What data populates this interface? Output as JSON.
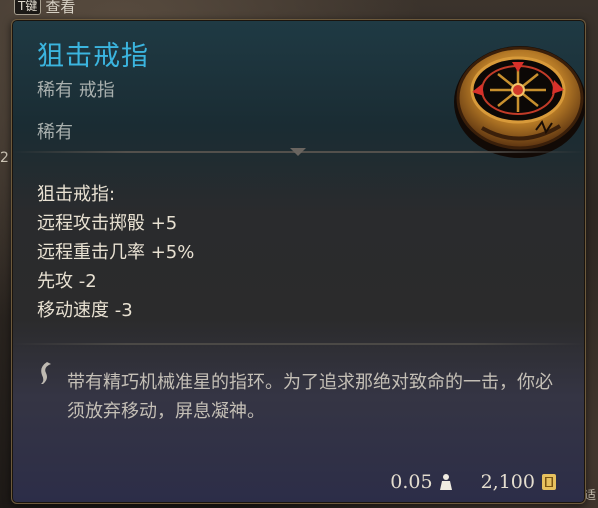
{
  "background": {
    "hint_key": "T键",
    "hint_text": "查看",
    "edge_left": "2",
    "edge_right": "适"
  },
  "tooltip": {
    "title": "狙击戒指",
    "subtitle": "稀有 戒指",
    "rarity": "稀有",
    "stats": [
      "狙击戒指:",
      "远程攻击掷骰 +5",
      "远程重击几率 +5%",
      "先攻 -2",
      "移动速度 -3"
    ],
    "flavor_text": "带有精巧机械准星的指环。为了追求那绝对致命的一击，你必须放弃移动，屏息凝神。",
    "weight": "0.05",
    "value": "2,100",
    "icons": {
      "item": "ring-icon",
      "flavor": "quill-icon",
      "weight": "weight-icon",
      "value": "gold-icon"
    },
    "colors": {
      "title": "#3bb5df",
      "border": "#6d5a3c"
    }
  }
}
